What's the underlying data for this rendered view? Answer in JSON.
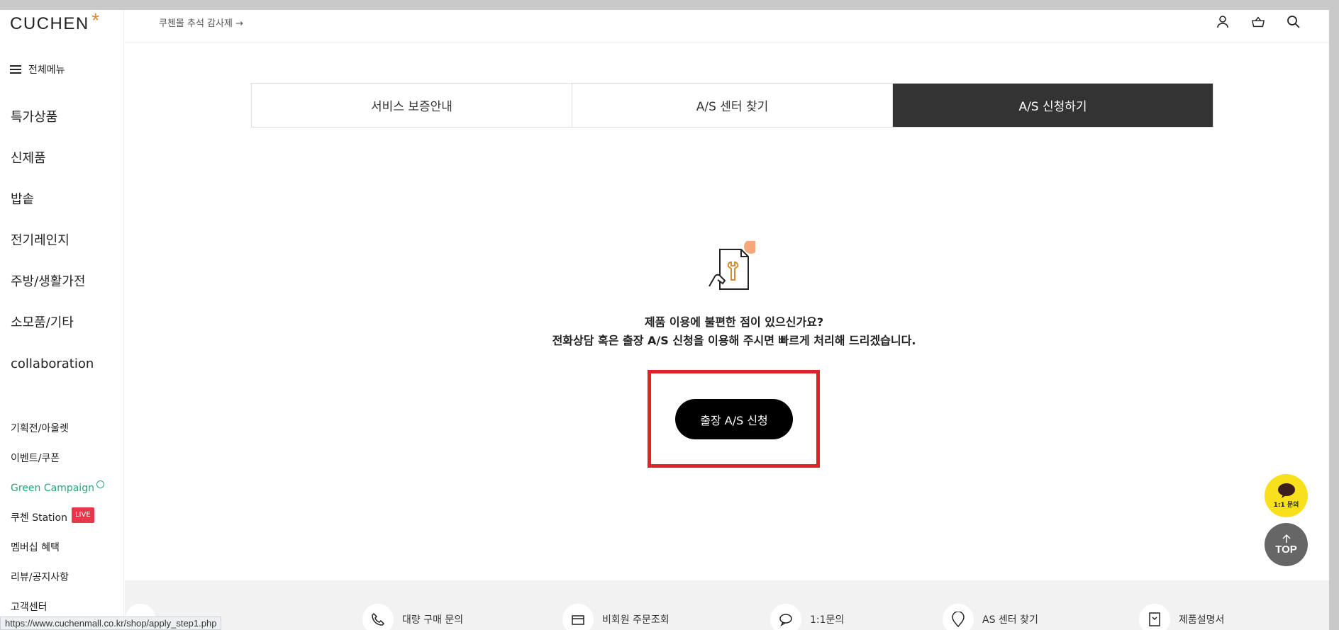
{
  "brand": {
    "logo_text": "CUCHEN",
    "logo_mark": "*"
  },
  "sidebar": {
    "menu_label": "전체메뉴",
    "categories": [
      {
        "label": "특가상품"
      },
      {
        "label": "신제품"
      },
      {
        "label": "밥솥"
      },
      {
        "label": "전기레인지"
      },
      {
        "label": "주방/생활가전"
      },
      {
        "label": "소모품/기타"
      },
      {
        "label": "collaboration"
      }
    ],
    "links": [
      {
        "label": "기획전/아울렛"
      },
      {
        "label": "이벤트/쿠폰"
      },
      {
        "label": "Green Campaign"
      },
      {
        "label": "쿠첸 Station",
        "badge": "LIVE"
      },
      {
        "label": "멤버십 혜택"
      },
      {
        "label": "리뷰/공지사항"
      },
      {
        "label": "고객센터"
      }
    ]
  },
  "topbar": {
    "promo": "쿠첸몰 추석 감사제  →"
  },
  "tabs": [
    {
      "label": "서비스 보증안내",
      "active": false
    },
    {
      "label": "A/S 센터 찾기",
      "active": false
    },
    {
      "label": "A/S 신청하기",
      "active": true
    }
  ],
  "main": {
    "line1": "제품 이용에 불편한 점이 있으신가요?",
    "line2": "전화상담 혹은 출장 A/S 신청을 이용해 주시면 빠르게 처리해 드리겠습니다.",
    "button": "출장 A/S 신청"
  },
  "footer_items": [
    {
      "label": "대량 구매 문의"
    },
    {
      "label": "비회원 주문조회"
    },
    {
      "label": "1:1문의"
    },
    {
      "label": "AS 센터 찾기"
    },
    {
      "label": "제품설명서"
    }
  ],
  "floating": {
    "chat_label": "1:1 문의",
    "top_label": "TOP"
  },
  "status_url": "https://www.cuchenmall.co.kr/shop/apply_step1.php",
  "colors": {
    "accent": "#e0882c",
    "active_tab": "#333333",
    "highlight": "#e02329",
    "chat": "#f8e01c",
    "green": "#2aa37a"
  }
}
